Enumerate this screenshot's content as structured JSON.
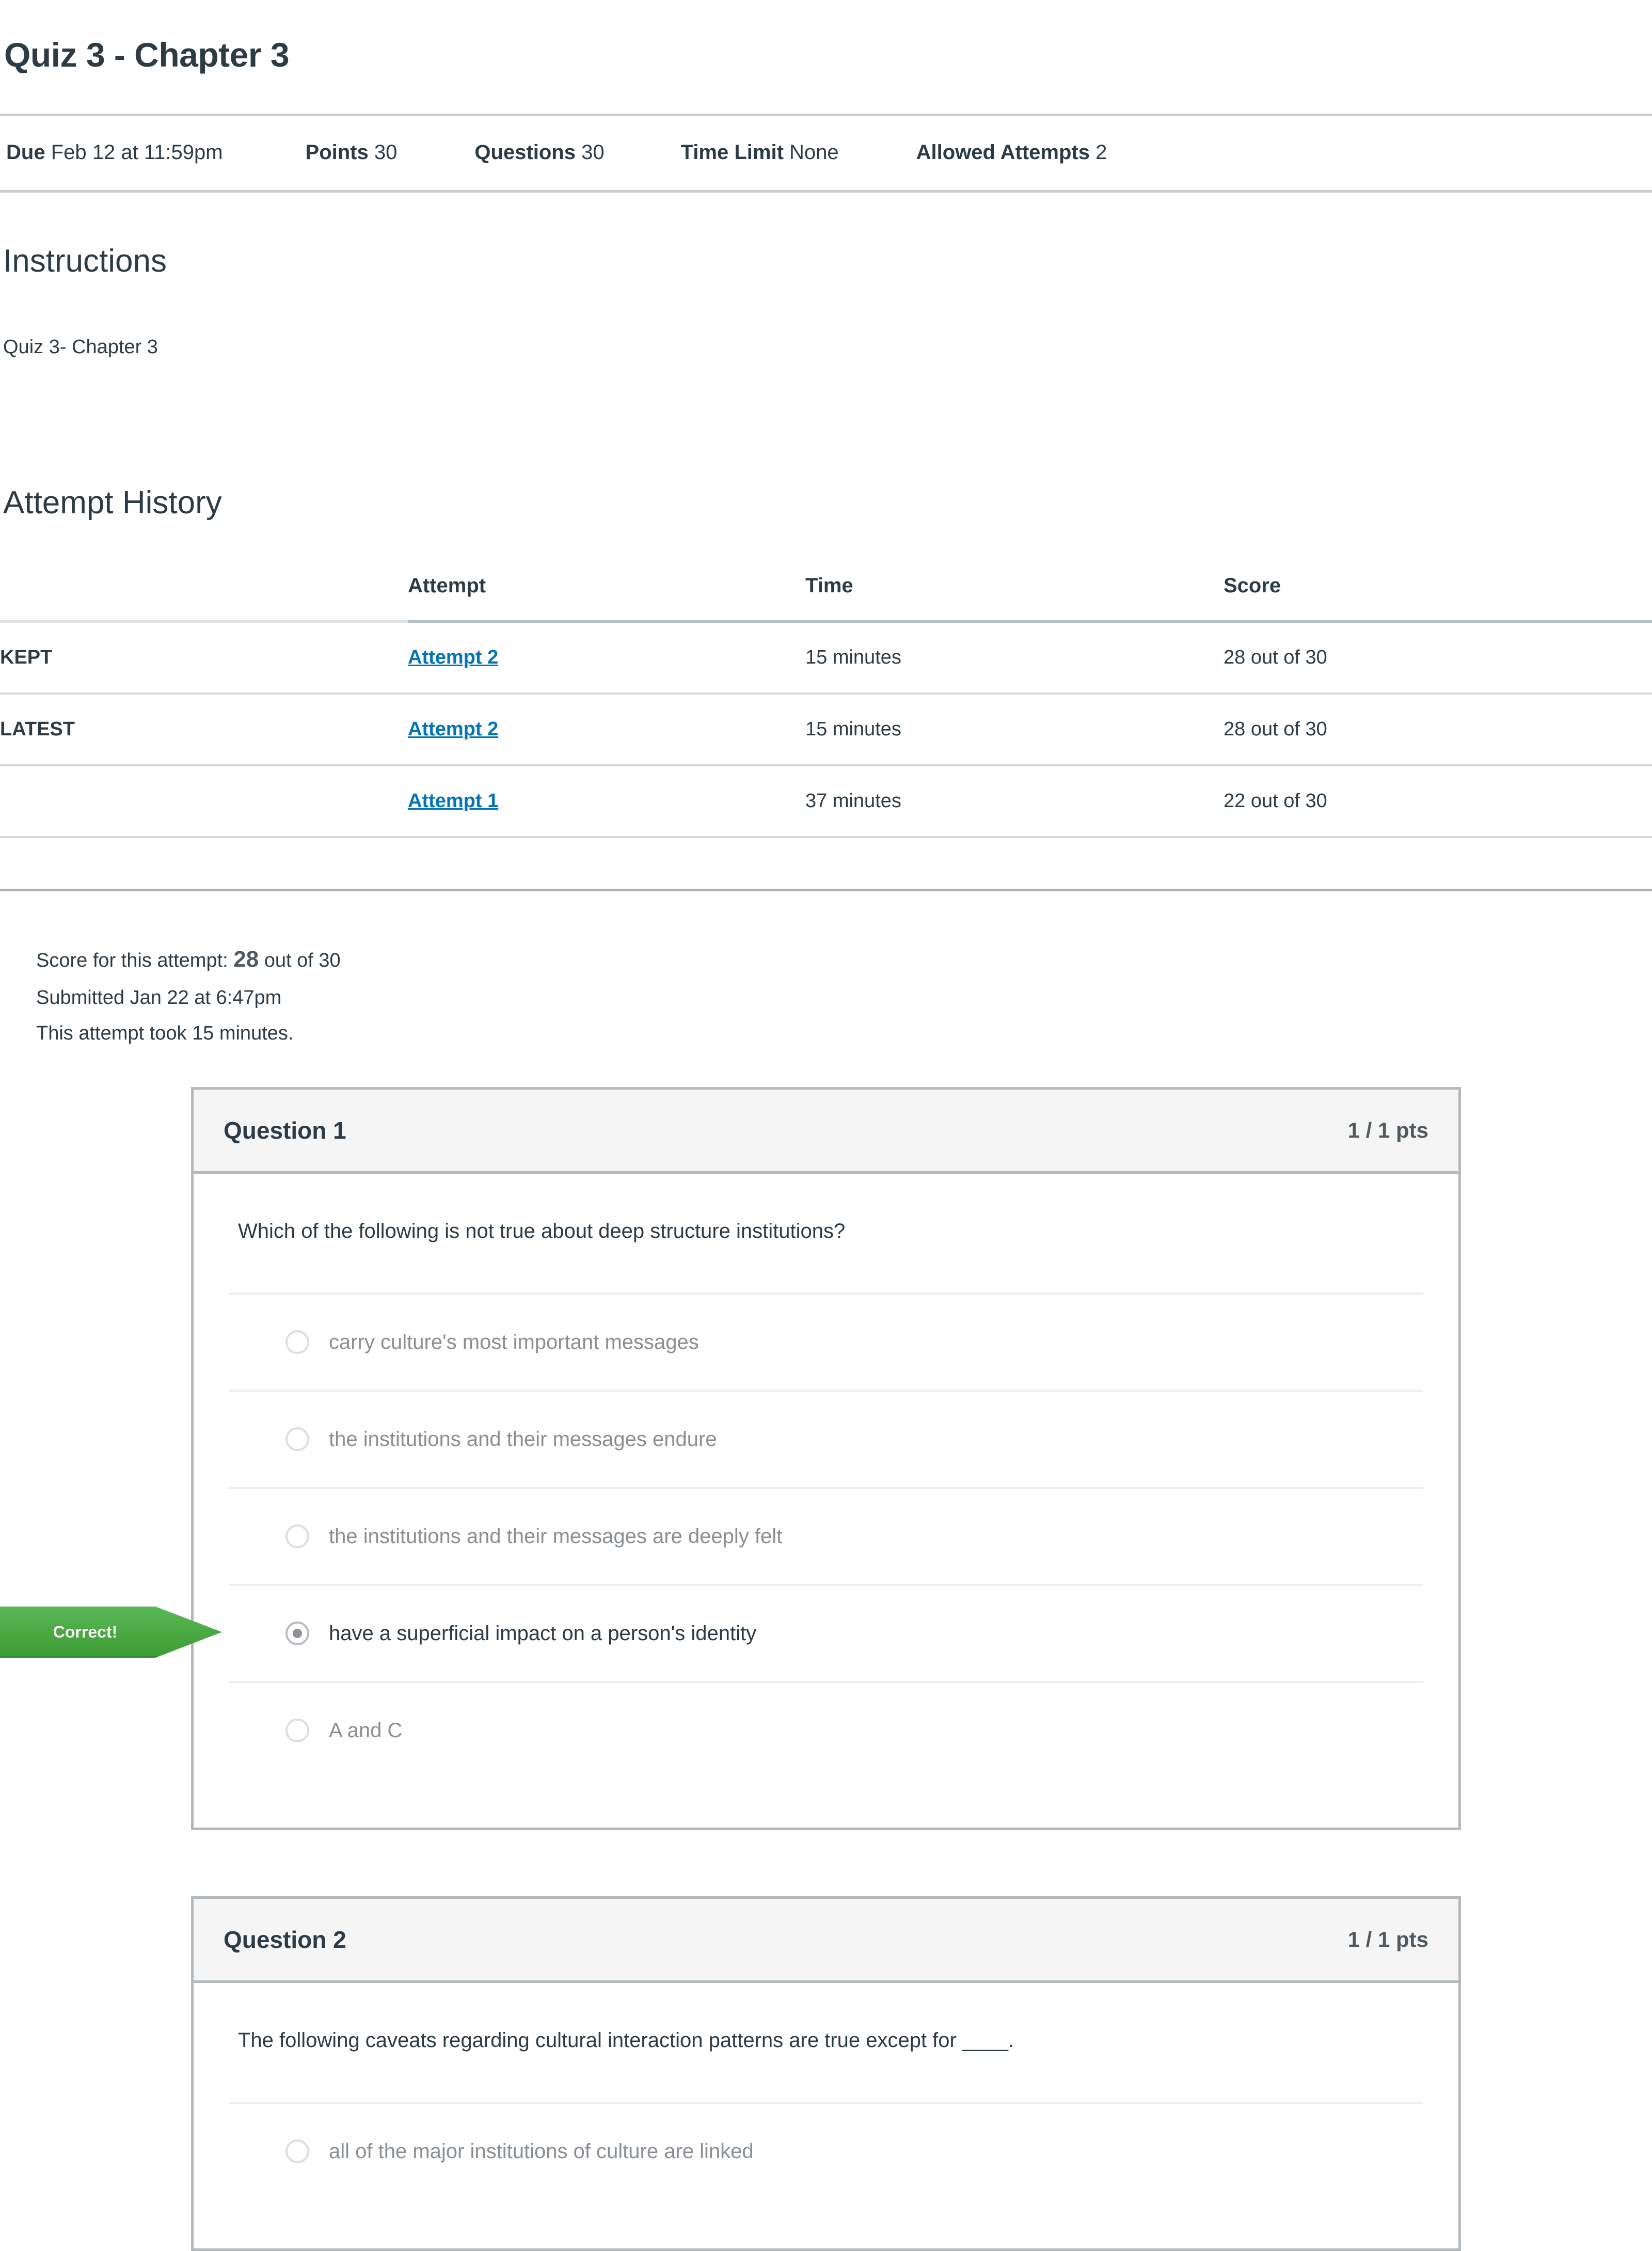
{
  "quiz": {
    "title": "Quiz 3 - Chapter 3"
  },
  "meta": {
    "due_label": "Due",
    "due_value": "Feb 12 at 11:59pm",
    "points_label": "Points",
    "points_value": "30",
    "questions_label": "Questions",
    "questions_value": "30",
    "time_limit_label": "Time Limit",
    "time_limit_value": "None",
    "allowed_attempts_label": "Allowed Attempts",
    "allowed_attempts_value": "2"
  },
  "instructions": {
    "heading": "Instructions",
    "body": "Quiz 3- Chapter 3"
  },
  "attempt_history": {
    "heading": "Attempt History",
    "columns": {
      "blank": "",
      "attempt": "Attempt",
      "time": "Time",
      "score": "Score"
    },
    "rows": [
      {
        "label": "KEPT",
        "attempt": "Attempt 2",
        "time": "15 minutes",
        "score": "28 out of 30"
      },
      {
        "label": "LATEST",
        "attempt": "Attempt 2",
        "time": "15 minutes",
        "score": "28 out of 30"
      },
      {
        "label": "",
        "attempt": "Attempt 1",
        "time": "37 minutes",
        "score": "22 out of 30"
      }
    ]
  },
  "score_summary": {
    "line1_prefix": "Score for this attempt: ",
    "line1_score": "28",
    "line1_suffix": " out of 30",
    "line2": "Submitted Jan 22 at 6:47pm",
    "line3": "This attempt took 15 minutes."
  },
  "correct_badge": {
    "label": "Correct!",
    "color": "#4aaa41"
  },
  "questions": [
    {
      "name": "Question 1",
      "points": "1 / 1 pts",
      "text": "Which of the following is not true about deep structure institutions?",
      "answers": [
        {
          "text": "carry culture's most important messages",
          "selected": false,
          "correct": false
        },
        {
          "text": "the institutions and their messages endure",
          "selected": false,
          "correct": false
        },
        {
          "text": "the institutions and their messages are deeply felt",
          "selected": false,
          "correct": false
        },
        {
          "text": "have a superficial impact on a person's identity",
          "selected": true,
          "correct": true
        },
        {
          "text": "A and C",
          "selected": false,
          "correct": false
        }
      ]
    },
    {
      "name": "Question 2",
      "points": "1 / 1 pts",
      "text": "The following caveats regarding cultural interaction patterns are true except for ____.",
      "answers": [
        {
          "text": "all of the major institutions of culture are linked",
          "selected": false,
          "correct": false
        }
      ]
    }
  ]
}
